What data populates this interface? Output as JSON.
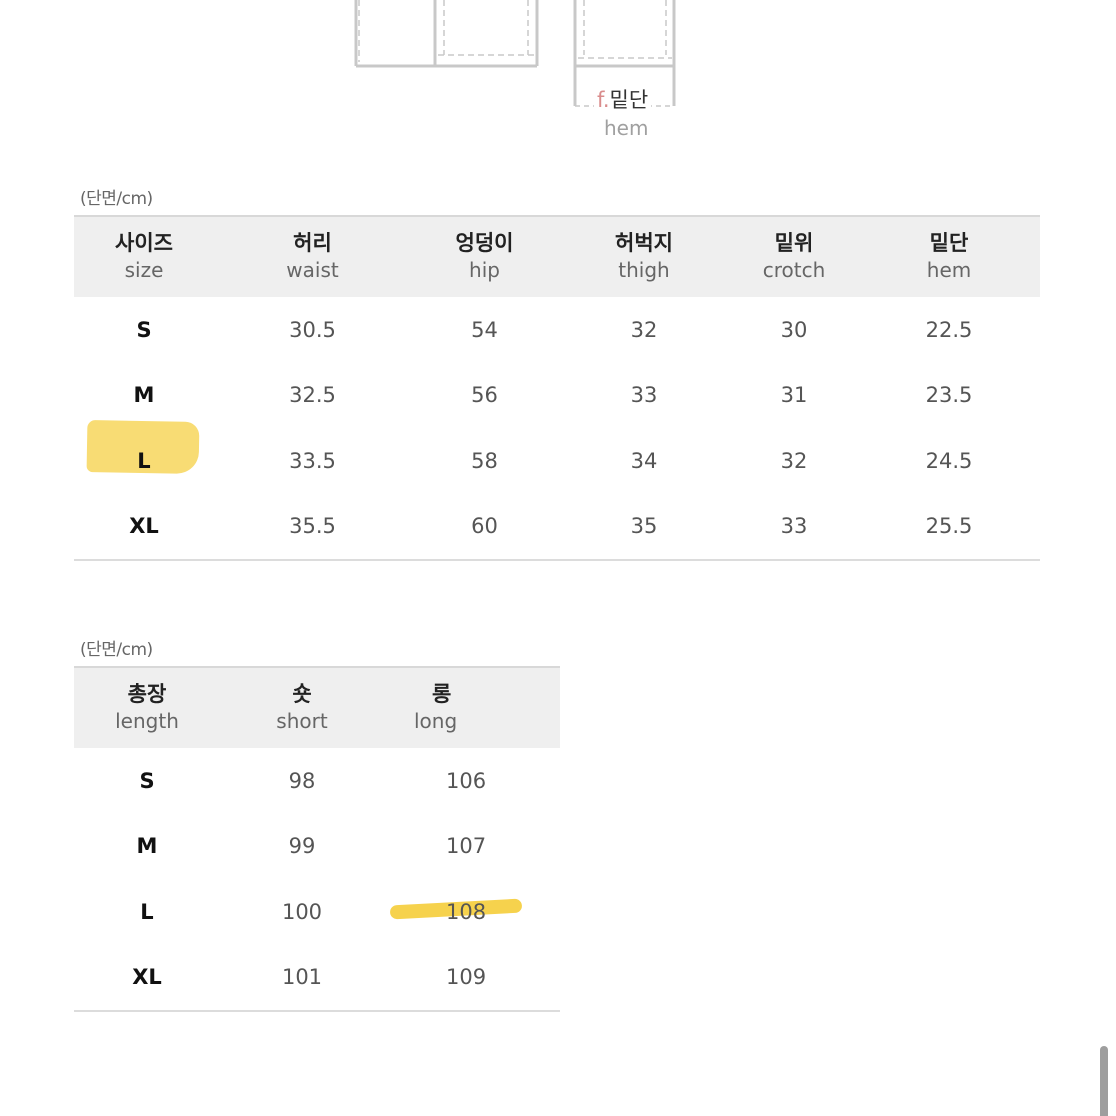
{
  "diagram": {
    "label_letter": "f.",
    "label_ko": "밑단",
    "label_en": "hem"
  },
  "table1": {
    "unit": "(단면/cm)",
    "headers": [
      {
        "ko": "사이즈",
        "en": "size"
      },
      {
        "ko": "허리",
        "en": "waist"
      },
      {
        "ko": "엉덩이",
        "en": "hip"
      },
      {
        "ko": "허벅지",
        "en": "thigh"
      },
      {
        "ko": "밑위",
        "en": "crotch"
      },
      {
        "ko": "밑단",
        "en": "hem"
      }
    ],
    "rows": [
      [
        "S",
        "30.5",
        "54",
        "32",
        "30",
        "22.5"
      ],
      [
        "M",
        "32.5",
        "56",
        "33",
        "31",
        "23.5"
      ],
      [
        "L",
        "33.5",
        "58",
        "34",
        "32",
        "24.5"
      ],
      [
        "XL",
        "35.5",
        "60",
        "35",
        "33",
        "25.5"
      ]
    ],
    "highlighted": {
      "row": 2,
      "col": 0,
      "color": "#f7d65c"
    }
  },
  "table2": {
    "unit": "(단면/cm)",
    "headers": [
      {
        "ko": "총장",
        "en": "length"
      },
      {
        "ko": "숏",
        "en": "short"
      },
      {
        "ko": "롱",
        "en": "long"
      }
    ],
    "rows": [
      [
        "S",
        "98",
        "106"
      ],
      [
        "M",
        "99",
        "107"
      ],
      [
        "L",
        "100",
        "108"
      ],
      [
        "XL",
        "101",
        "109"
      ]
    ],
    "highlighted": {
      "row": 2,
      "col": 2,
      "color": "#f5cd3a"
    }
  }
}
